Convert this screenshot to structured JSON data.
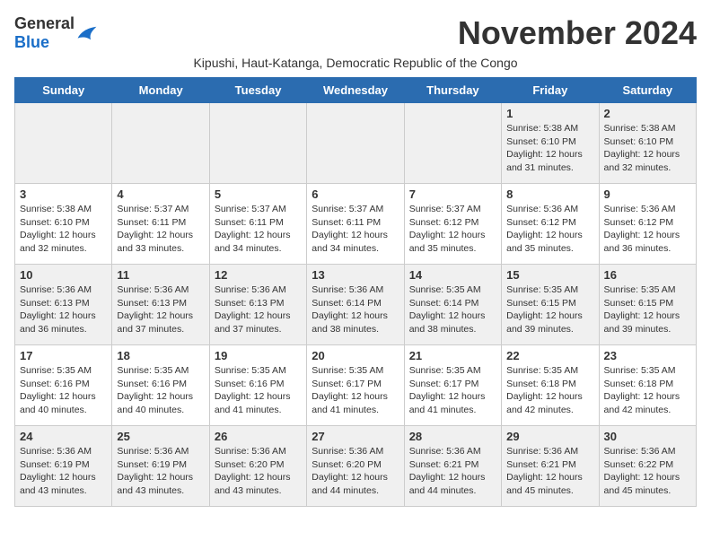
{
  "header": {
    "logo_general": "General",
    "logo_blue": "Blue",
    "month": "November 2024",
    "subtitle": "Kipushi, Haut-Katanga, Democratic Republic of the Congo"
  },
  "days_of_week": [
    "Sunday",
    "Monday",
    "Tuesday",
    "Wednesday",
    "Thursday",
    "Friday",
    "Saturday"
  ],
  "weeks": [
    [
      {
        "day": "",
        "info": ""
      },
      {
        "day": "",
        "info": ""
      },
      {
        "day": "",
        "info": ""
      },
      {
        "day": "",
        "info": ""
      },
      {
        "day": "",
        "info": ""
      },
      {
        "day": "1",
        "info": "Sunrise: 5:38 AM\nSunset: 6:10 PM\nDaylight: 12 hours and 31 minutes."
      },
      {
        "day": "2",
        "info": "Sunrise: 5:38 AM\nSunset: 6:10 PM\nDaylight: 12 hours and 32 minutes."
      }
    ],
    [
      {
        "day": "3",
        "info": "Sunrise: 5:38 AM\nSunset: 6:10 PM\nDaylight: 12 hours and 32 minutes."
      },
      {
        "day": "4",
        "info": "Sunrise: 5:37 AM\nSunset: 6:11 PM\nDaylight: 12 hours and 33 minutes."
      },
      {
        "day": "5",
        "info": "Sunrise: 5:37 AM\nSunset: 6:11 PM\nDaylight: 12 hours and 34 minutes."
      },
      {
        "day": "6",
        "info": "Sunrise: 5:37 AM\nSunset: 6:11 PM\nDaylight: 12 hours and 34 minutes."
      },
      {
        "day": "7",
        "info": "Sunrise: 5:37 AM\nSunset: 6:12 PM\nDaylight: 12 hours and 35 minutes."
      },
      {
        "day": "8",
        "info": "Sunrise: 5:36 AM\nSunset: 6:12 PM\nDaylight: 12 hours and 35 minutes."
      },
      {
        "day": "9",
        "info": "Sunrise: 5:36 AM\nSunset: 6:12 PM\nDaylight: 12 hours and 36 minutes."
      }
    ],
    [
      {
        "day": "10",
        "info": "Sunrise: 5:36 AM\nSunset: 6:13 PM\nDaylight: 12 hours and 36 minutes."
      },
      {
        "day": "11",
        "info": "Sunrise: 5:36 AM\nSunset: 6:13 PM\nDaylight: 12 hours and 37 minutes."
      },
      {
        "day": "12",
        "info": "Sunrise: 5:36 AM\nSunset: 6:13 PM\nDaylight: 12 hours and 37 minutes."
      },
      {
        "day": "13",
        "info": "Sunrise: 5:36 AM\nSunset: 6:14 PM\nDaylight: 12 hours and 38 minutes."
      },
      {
        "day": "14",
        "info": "Sunrise: 5:35 AM\nSunset: 6:14 PM\nDaylight: 12 hours and 38 minutes."
      },
      {
        "day": "15",
        "info": "Sunrise: 5:35 AM\nSunset: 6:15 PM\nDaylight: 12 hours and 39 minutes."
      },
      {
        "day": "16",
        "info": "Sunrise: 5:35 AM\nSunset: 6:15 PM\nDaylight: 12 hours and 39 minutes."
      }
    ],
    [
      {
        "day": "17",
        "info": "Sunrise: 5:35 AM\nSunset: 6:16 PM\nDaylight: 12 hours and 40 minutes."
      },
      {
        "day": "18",
        "info": "Sunrise: 5:35 AM\nSunset: 6:16 PM\nDaylight: 12 hours and 40 minutes."
      },
      {
        "day": "19",
        "info": "Sunrise: 5:35 AM\nSunset: 6:16 PM\nDaylight: 12 hours and 41 minutes."
      },
      {
        "day": "20",
        "info": "Sunrise: 5:35 AM\nSunset: 6:17 PM\nDaylight: 12 hours and 41 minutes."
      },
      {
        "day": "21",
        "info": "Sunrise: 5:35 AM\nSunset: 6:17 PM\nDaylight: 12 hours and 41 minutes."
      },
      {
        "day": "22",
        "info": "Sunrise: 5:35 AM\nSunset: 6:18 PM\nDaylight: 12 hours and 42 minutes."
      },
      {
        "day": "23",
        "info": "Sunrise: 5:35 AM\nSunset: 6:18 PM\nDaylight: 12 hours and 42 minutes."
      }
    ],
    [
      {
        "day": "24",
        "info": "Sunrise: 5:36 AM\nSunset: 6:19 PM\nDaylight: 12 hours and 43 minutes."
      },
      {
        "day": "25",
        "info": "Sunrise: 5:36 AM\nSunset: 6:19 PM\nDaylight: 12 hours and 43 minutes."
      },
      {
        "day": "26",
        "info": "Sunrise: 5:36 AM\nSunset: 6:20 PM\nDaylight: 12 hours and 43 minutes."
      },
      {
        "day": "27",
        "info": "Sunrise: 5:36 AM\nSunset: 6:20 PM\nDaylight: 12 hours and 44 minutes."
      },
      {
        "day": "28",
        "info": "Sunrise: 5:36 AM\nSunset: 6:21 PM\nDaylight: 12 hours and 44 minutes."
      },
      {
        "day": "29",
        "info": "Sunrise: 5:36 AM\nSunset: 6:21 PM\nDaylight: 12 hours and 45 minutes."
      },
      {
        "day": "30",
        "info": "Sunrise: 5:36 AM\nSunset: 6:22 PM\nDaylight: 12 hours and 45 minutes."
      }
    ]
  ]
}
